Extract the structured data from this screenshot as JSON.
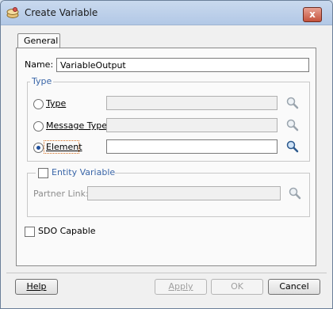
{
  "window": {
    "title": "Create Variable",
    "close_label": "x"
  },
  "tabs": [
    {
      "label": "General"
    }
  ],
  "name": {
    "label": "Name:",
    "value": "VariableOutput"
  },
  "type_group": {
    "legend": "Type",
    "options": [
      {
        "label": "Type",
        "selected": false
      },
      {
        "label": "Message Type",
        "selected": false
      },
      {
        "label": "Element",
        "selected": true
      }
    ]
  },
  "entity_group": {
    "legend": "Entity Variable",
    "checked": false,
    "partner_link_label": "Partner Link:"
  },
  "sdo": {
    "label": "SDO Capable",
    "checked": false
  },
  "buttons": {
    "help": "Help",
    "apply": "Apply",
    "ok": "OK",
    "cancel": "Cancel"
  },
  "colors": {
    "accent": "#3a66a8",
    "focus": "#d36b1c"
  },
  "icons": {
    "app": "variable-app-icon",
    "search": "magnifier-icon",
    "close": "close-icon"
  }
}
